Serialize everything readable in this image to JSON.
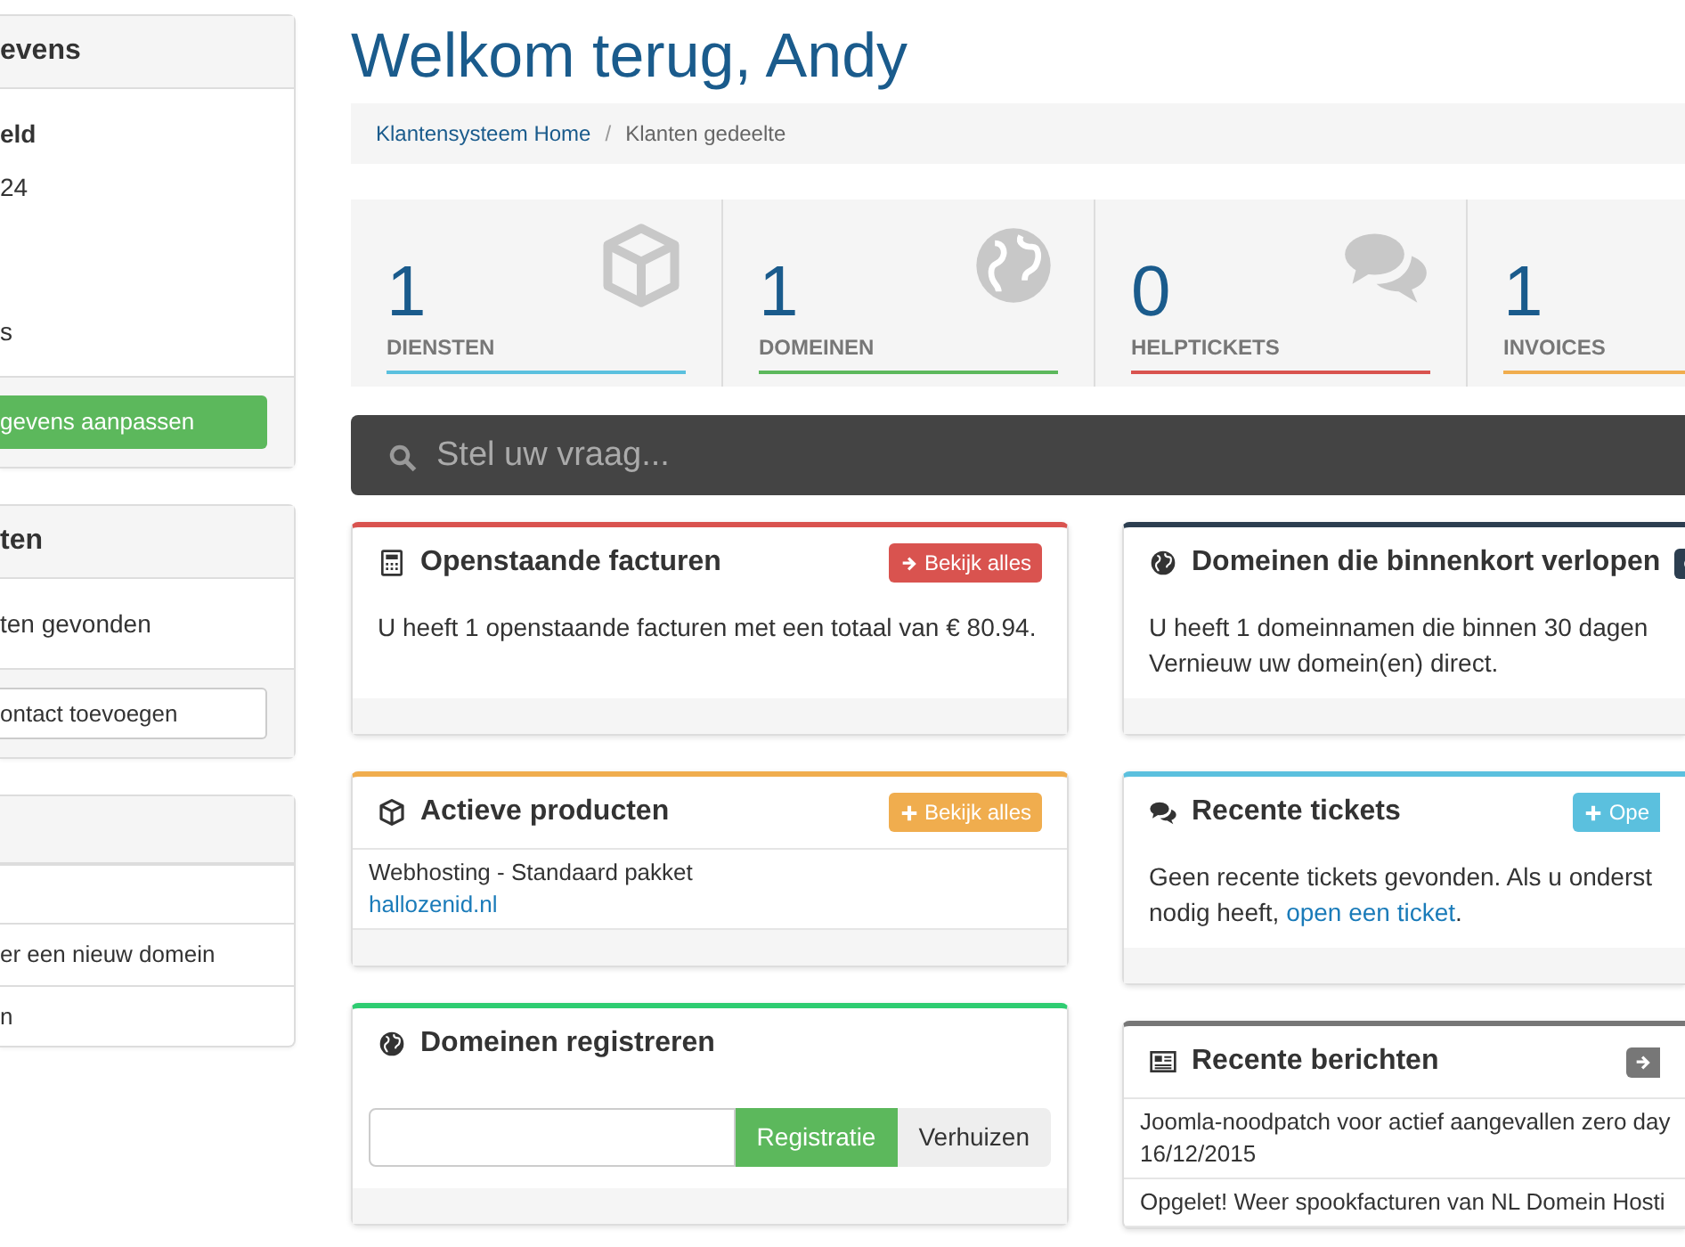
{
  "page_title": "Welkom terug, Andy",
  "breadcrumb": [
    {
      "label": "Klantensysteem Home"
    },
    {
      "label": "Klanten gedeelte"
    }
  ],
  "breadcrumb_separator": "/",
  "sidebar": [
    {
      "kind": "profile",
      "title": "evens",
      "name": "eld",
      "address_lines": [
        "24"
      ],
      "extra_lines": [
        "s"
      ],
      "button": {
        "label": "gevens aanpassen",
        "kind": "success"
      }
    },
    {
      "kind": "info",
      "title": "ten",
      "text": "ten gevonden",
      "button": {
        "label": "ontact toevoegen",
        "kind": "default"
      }
    },
    {
      "kind": "list",
      "items": [
        "er een nieuw domein",
        "n"
      ]
    }
  ],
  "stats": [
    {
      "value": "1",
      "label": "DIENSTEN",
      "color": "#5bc0de"
    },
    {
      "value": "1",
      "label": "DOMEINEN",
      "color": "#5cb85c"
    },
    {
      "value": "0",
      "label": "HELPTICKETS",
      "color": "#d9534f"
    },
    {
      "value": "1",
      "label": "INVOICES",
      "color": "#f0ad4e"
    }
  ],
  "search": {
    "placeholder": "Stel uw vraag..."
  },
  "panels_left": [
    {
      "title": "Openstaande facturen",
      "color": "#d9534f",
      "button": {
        "label": "Bekijk alles"
      },
      "body": {
        "kind": "text",
        "lines": [
          {
            "text": "U heeft 1 openstaande facturen met een totaal van € 80.94."
          }
        ]
      }
    },
    {
      "title": "Actieve producten",
      "color": "#f0ad4e",
      "button": {
        "label": "Bekijk alles"
      },
      "body": {
        "kind": "list",
        "items": [
          {
            "name": "Webhosting - Standaard pakket",
            "link": "hallozenid.nl"
          }
        ]
      }
    },
    {
      "title": "Domeinen registreren",
      "color": "#2ecc71",
      "body": {
        "kind": "domain_form",
        "buttons": [
          {
            "label": "Registratie",
            "selected": true
          },
          {
            "label": "Verhuizen",
            "selected": false
          }
        ]
      }
    }
  ],
  "panels_right": [
    {
      "title": "Domeinen die binnenkort verlopen",
      "color": "#2c3e50",
      "icon_button": true,
      "body": {
        "kind": "text",
        "lines": [
          {
            "text": "U heeft 1 domeinnamen die binnen 30 dagen"
          },
          {
            "text": "Vernieuw uw domein(en) direct."
          }
        ]
      }
    },
    {
      "title": "Recente tickets",
      "color": "#5bc0de",
      "button": {
        "label": "Ope"
      },
      "body": {
        "kind": "text",
        "lines": [
          {
            "text": "Geen recente tickets gevonden. Als u onderst"
          },
          {
            "text": "nodig heeft, ",
            "link": "open een ticket",
            "after": "."
          }
        ]
      }
    },
    {
      "title": "Recente berichten",
      "color": "#777777",
      "icon_button": true,
      "body": {
        "kind": "list",
        "items": [
          {
            "name": "Joomla-noodpatch voor actief aangevallen zero day",
            "date": "16/12/2015"
          },
          {
            "name": "Opgelet! Weer spookfacturen van NL Domein Hosti"
          }
        ]
      }
    }
  ]
}
